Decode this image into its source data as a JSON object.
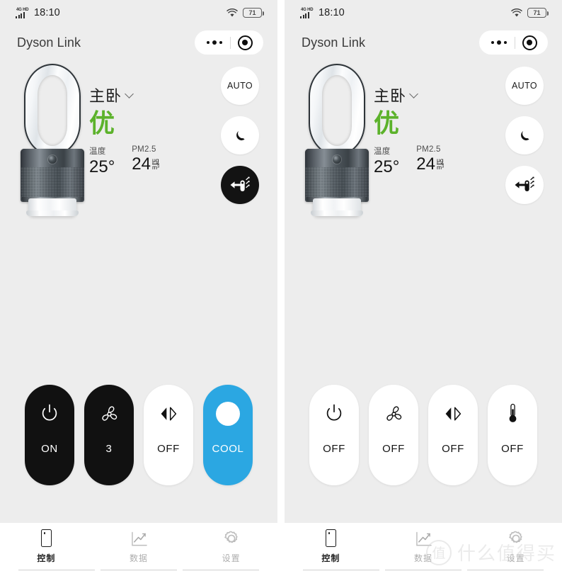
{
  "status_bar": {
    "network": "4G HD",
    "time": "18:10",
    "battery": "71",
    "wifi_icon": "wifi-icon",
    "signal_icon": "signal-bars-icon"
  },
  "header": {
    "title": "Dyson Link",
    "more_icon": "more-dots-icon",
    "target_icon": "target-record-icon"
  },
  "hero": {
    "device_icon": "dyson-purifier-illustration",
    "room_name": "主卧",
    "room_chevron_icon": "chevron-down-icon",
    "air_quality": "优",
    "air_quality_color": "#5cb22b",
    "metrics": [
      {
        "label": "温度",
        "value": "25°",
        "unit_top": "",
        "unit_bottom": ""
      },
      {
        "label": "PM2.5",
        "value": "24",
        "unit_top": "μg",
        "unit_bottom": "m³"
      }
    ]
  },
  "modes_left": [
    {
      "name": "auto-mode-button",
      "label": "AUTO",
      "icon": "auto-text",
      "active": false
    },
    {
      "name": "night-mode-button",
      "label": "",
      "icon": "moon-icon",
      "active": false
    },
    {
      "name": "airflow-direction-button",
      "label": "",
      "icon": "airflow-icon",
      "active": true
    }
  ],
  "modes_right": [
    {
      "name": "auto-mode-button",
      "label": "AUTO",
      "icon": "auto-text",
      "active": false
    },
    {
      "name": "night-mode-button",
      "label": "",
      "icon": "moon-icon",
      "active": false
    },
    {
      "name": "airflow-direction-button",
      "label": "",
      "icon": "airflow-icon",
      "active": false
    }
  ],
  "controls_left": [
    {
      "name": "power-button",
      "icon": "power-icon",
      "caption": "ON",
      "style": "dark"
    },
    {
      "name": "fan-speed-button",
      "icon": "fan-icon",
      "caption": "3",
      "style": "dark"
    },
    {
      "name": "oscillation-button",
      "icon": "oscillation-icon",
      "caption": "OFF",
      "style": "light"
    },
    {
      "name": "cool-mode-button",
      "icon": "cool-dot-icon",
      "caption": "COOL",
      "style": "cool"
    }
  ],
  "controls_right": [
    {
      "name": "power-button",
      "icon": "power-icon",
      "caption": "OFF",
      "style": "light"
    },
    {
      "name": "fan-speed-button",
      "icon": "fan-icon",
      "caption": "OFF",
      "style": "light"
    },
    {
      "name": "oscillation-button",
      "icon": "oscillation-icon",
      "caption": "OFF",
      "style": "light"
    },
    {
      "name": "heat-mode-button",
      "icon": "thermometer-icon",
      "caption": "OFF",
      "style": "light"
    }
  ],
  "tabs": [
    {
      "name": "tab-control",
      "label": "控制",
      "icon": "phone-remote-icon",
      "active": true
    },
    {
      "name": "tab-data",
      "label": "数据",
      "icon": "chart-icon",
      "active": false
    },
    {
      "name": "tab-settings",
      "label": "设置",
      "icon": "gear-icon",
      "active": false
    }
  ],
  "watermark": {
    "badge": "值",
    "text": "什么值得买"
  },
  "colors": {
    "background": "#ededed",
    "accent_blue": "#2ba7e2",
    "accent_green": "#5cb22b",
    "dark": "#111111"
  }
}
